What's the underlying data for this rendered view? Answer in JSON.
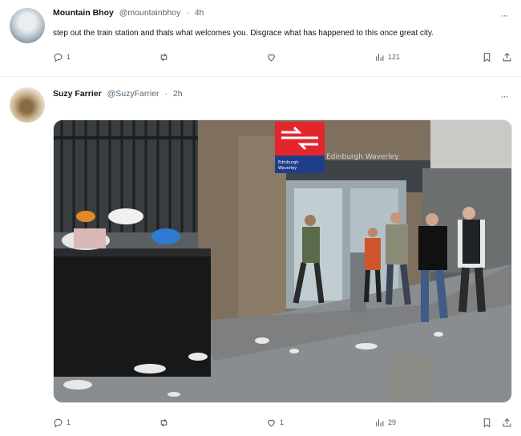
{
  "tweets": [
    {
      "author": "Mountain Bhoy",
      "handle": "@mountainbhoy",
      "separator": "·",
      "time": "4h",
      "text": "step out the train station and thats what welcomes you. Disgrace what has happened to this once great city.",
      "replies": "1",
      "retweets": "",
      "likes": "",
      "views": "121"
    },
    {
      "author": "Suzy Farrier",
      "handle": "@SuzyFarrier",
      "separator": "·",
      "time": "2h",
      "replies": "1",
      "retweets": "",
      "likes": "1",
      "views": "29"
    }
  ],
  "media": {
    "station_sign_line1": "Edinburgh",
    "station_sign_line2": "Waverley"
  },
  "icons": [
    "reply-icon",
    "retweet-icon",
    "like-icon",
    "views-icon",
    "bookmark-icon",
    "share-icon",
    "more-icon"
  ],
  "colors": {
    "text": "#0f1419",
    "secondary": "#536471",
    "divider": "#eff3f4",
    "rail_red": "#e3262c"
  }
}
